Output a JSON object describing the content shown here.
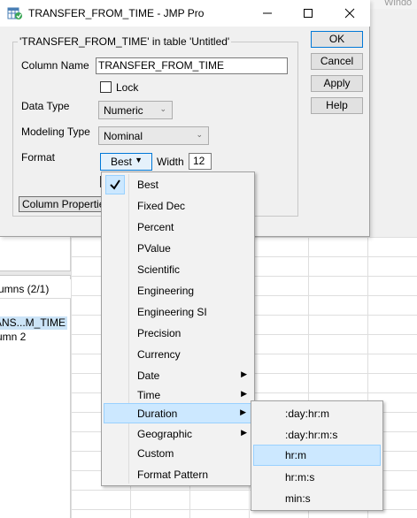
{
  "background_window": {
    "title_fragment": "Windo",
    "columns_header": "umns (2/1)",
    "columns": [
      "ANS...M_TIME",
      "umn 2"
    ]
  },
  "dialog": {
    "title": "TRANSFER_FROM_TIME - JMP Pro",
    "group_title": "'TRANSFER_FROM_TIME' in table 'Untitled'",
    "column_name_label": "Column Name",
    "column_name_value": "TRANSFER_FROM_TIME",
    "lock_label": "Lock",
    "lock_checked": false,
    "data_type_label": "Data Type",
    "data_type_value": "Numeric",
    "modeling_type_label": "Modeling Type",
    "modeling_type_value": "Nominal",
    "format_label": "Format",
    "format_value": "Best",
    "width_label": "Width",
    "width_value": "12",
    "column_properties_label": "Column Properties",
    "buttons": {
      "ok": "OK",
      "cancel": "Cancel",
      "apply": "Apply",
      "help": "Help"
    }
  },
  "format_menu": {
    "items": [
      {
        "label": "Best",
        "checked": true
      },
      {
        "label": "Fixed Dec"
      },
      {
        "label": "Percent"
      },
      {
        "label": "PValue"
      },
      {
        "label": "Scientific"
      },
      {
        "label": "Engineering"
      },
      {
        "label": "Engineering SI"
      },
      {
        "label": "Precision"
      },
      {
        "label": "Currency"
      },
      {
        "label": "Date",
        "submenu": true
      },
      {
        "label": "Time",
        "submenu": true
      },
      {
        "label": "Duration",
        "submenu": true,
        "highlighted": true
      },
      {
        "label": "Geographic",
        "submenu": true
      },
      {
        "label": "Custom"
      },
      {
        "label": "Format Pattern"
      }
    ]
  },
  "duration_submenu": {
    "items": [
      {
        "label": ":day:hr:m"
      },
      {
        "label": ":day:hr:m:s"
      },
      {
        "label": "hr:m",
        "highlighted": true
      },
      {
        "label": "hr:m:s"
      },
      {
        "label": "min:s"
      }
    ]
  },
  "colors": {
    "highlight": "#cce8ff",
    "highlight_border": "#99d1ff",
    "selected_row": "#cce4f7",
    "accent": "#0078d7"
  },
  "icons": [
    "jmp-app-icon",
    "minimize-icon",
    "maximize-icon",
    "close-icon",
    "dropdown-arrow-icon",
    "checkmark-icon",
    "submenu-arrow-icon"
  ]
}
